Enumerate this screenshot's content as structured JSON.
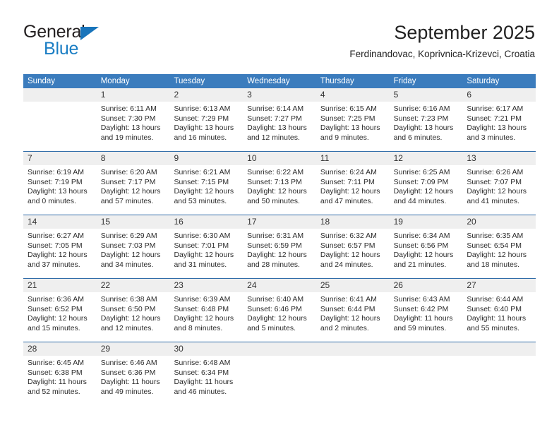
{
  "brand": {
    "name_part1": "General",
    "name_part2": "Blue",
    "triangle_icon": "triangle-icon",
    "color_dark": "#231f20",
    "color_blue": "#1b7ec4"
  },
  "header": {
    "title": "September 2025",
    "subtitle": "Ferdinandovac, Koprivnica-Krizevci, Croatia"
  },
  "theme": {
    "header_blue": "#3b7cbd",
    "rule_blue": "#2f6ca8",
    "daynum_band": "#efefef",
    "text": "#2b2b2b"
  },
  "calendar": {
    "weekdays": [
      "Sunday",
      "Monday",
      "Tuesday",
      "Wednesday",
      "Thursday",
      "Friday",
      "Saturday"
    ],
    "weeks": [
      {
        "daynums": [
          "",
          "1",
          "2",
          "3",
          "4",
          "5",
          "6"
        ],
        "cells": [
          {
            "lines": []
          },
          {
            "lines": [
              "Sunrise: 6:11 AM",
              "Sunset: 7:30 PM",
              "Daylight: 13 hours",
              "and 19 minutes."
            ]
          },
          {
            "lines": [
              "Sunrise: 6:13 AM",
              "Sunset: 7:29 PM",
              "Daylight: 13 hours",
              "and 16 minutes."
            ]
          },
          {
            "lines": [
              "Sunrise: 6:14 AM",
              "Sunset: 7:27 PM",
              "Daylight: 13 hours",
              "and 12 minutes."
            ]
          },
          {
            "lines": [
              "Sunrise: 6:15 AM",
              "Sunset: 7:25 PM",
              "Daylight: 13 hours",
              "and 9 minutes."
            ]
          },
          {
            "lines": [
              "Sunrise: 6:16 AM",
              "Sunset: 7:23 PM",
              "Daylight: 13 hours",
              "and 6 minutes."
            ]
          },
          {
            "lines": [
              "Sunrise: 6:17 AM",
              "Sunset: 7:21 PM",
              "Daylight: 13 hours",
              "and 3 minutes."
            ]
          }
        ]
      },
      {
        "daynums": [
          "7",
          "8",
          "9",
          "10",
          "11",
          "12",
          "13"
        ],
        "cells": [
          {
            "lines": [
              "Sunrise: 6:19 AM",
              "Sunset: 7:19 PM",
              "Daylight: 13 hours",
              "and 0 minutes."
            ]
          },
          {
            "lines": [
              "Sunrise: 6:20 AM",
              "Sunset: 7:17 PM",
              "Daylight: 12 hours",
              "and 57 minutes."
            ]
          },
          {
            "lines": [
              "Sunrise: 6:21 AM",
              "Sunset: 7:15 PM",
              "Daylight: 12 hours",
              "and 53 minutes."
            ]
          },
          {
            "lines": [
              "Sunrise: 6:22 AM",
              "Sunset: 7:13 PM",
              "Daylight: 12 hours",
              "and 50 minutes."
            ]
          },
          {
            "lines": [
              "Sunrise: 6:24 AM",
              "Sunset: 7:11 PM",
              "Daylight: 12 hours",
              "and 47 minutes."
            ]
          },
          {
            "lines": [
              "Sunrise: 6:25 AM",
              "Sunset: 7:09 PM",
              "Daylight: 12 hours",
              "and 44 minutes."
            ]
          },
          {
            "lines": [
              "Sunrise: 6:26 AM",
              "Sunset: 7:07 PM",
              "Daylight: 12 hours",
              "and 41 minutes."
            ]
          }
        ]
      },
      {
        "daynums": [
          "14",
          "15",
          "16",
          "17",
          "18",
          "19",
          "20"
        ],
        "cells": [
          {
            "lines": [
              "Sunrise: 6:27 AM",
              "Sunset: 7:05 PM",
              "Daylight: 12 hours",
              "and 37 minutes."
            ]
          },
          {
            "lines": [
              "Sunrise: 6:29 AM",
              "Sunset: 7:03 PM",
              "Daylight: 12 hours",
              "and 34 minutes."
            ]
          },
          {
            "lines": [
              "Sunrise: 6:30 AM",
              "Sunset: 7:01 PM",
              "Daylight: 12 hours",
              "and 31 minutes."
            ]
          },
          {
            "lines": [
              "Sunrise: 6:31 AM",
              "Sunset: 6:59 PM",
              "Daylight: 12 hours",
              "and 28 minutes."
            ]
          },
          {
            "lines": [
              "Sunrise: 6:32 AM",
              "Sunset: 6:57 PM",
              "Daylight: 12 hours",
              "and 24 minutes."
            ]
          },
          {
            "lines": [
              "Sunrise: 6:34 AM",
              "Sunset: 6:56 PM",
              "Daylight: 12 hours",
              "and 21 minutes."
            ]
          },
          {
            "lines": [
              "Sunrise: 6:35 AM",
              "Sunset: 6:54 PM",
              "Daylight: 12 hours",
              "and 18 minutes."
            ]
          }
        ]
      },
      {
        "daynums": [
          "21",
          "22",
          "23",
          "24",
          "25",
          "26",
          "27"
        ],
        "cells": [
          {
            "lines": [
              "Sunrise: 6:36 AM",
              "Sunset: 6:52 PM",
              "Daylight: 12 hours",
              "and 15 minutes."
            ]
          },
          {
            "lines": [
              "Sunrise: 6:38 AM",
              "Sunset: 6:50 PM",
              "Daylight: 12 hours",
              "and 12 minutes."
            ]
          },
          {
            "lines": [
              "Sunrise: 6:39 AM",
              "Sunset: 6:48 PM",
              "Daylight: 12 hours",
              "and 8 minutes."
            ]
          },
          {
            "lines": [
              "Sunrise: 6:40 AM",
              "Sunset: 6:46 PM",
              "Daylight: 12 hours",
              "and 5 minutes."
            ]
          },
          {
            "lines": [
              "Sunrise: 6:41 AM",
              "Sunset: 6:44 PM",
              "Daylight: 12 hours",
              "and 2 minutes."
            ]
          },
          {
            "lines": [
              "Sunrise: 6:43 AM",
              "Sunset: 6:42 PM",
              "Daylight: 11 hours",
              "and 59 minutes."
            ]
          },
          {
            "lines": [
              "Sunrise: 6:44 AM",
              "Sunset: 6:40 PM",
              "Daylight: 11 hours",
              "and 55 minutes."
            ]
          }
        ]
      },
      {
        "daynums": [
          "28",
          "29",
          "30",
          "",
          "",
          "",
          ""
        ],
        "cells": [
          {
            "lines": [
              "Sunrise: 6:45 AM",
              "Sunset: 6:38 PM",
              "Daylight: 11 hours",
              "and 52 minutes."
            ]
          },
          {
            "lines": [
              "Sunrise: 6:46 AM",
              "Sunset: 6:36 PM",
              "Daylight: 11 hours",
              "and 49 minutes."
            ]
          },
          {
            "lines": [
              "Sunrise: 6:48 AM",
              "Sunset: 6:34 PM",
              "Daylight: 11 hours",
              "and 46 minutes."
            ]
          },
          {
            "lines": []
          },
          {
            "lines": []
          },
          {
            "lines": []
          },
          {
            "lines": []
          }
        ]
      }
    ]
  }
}
